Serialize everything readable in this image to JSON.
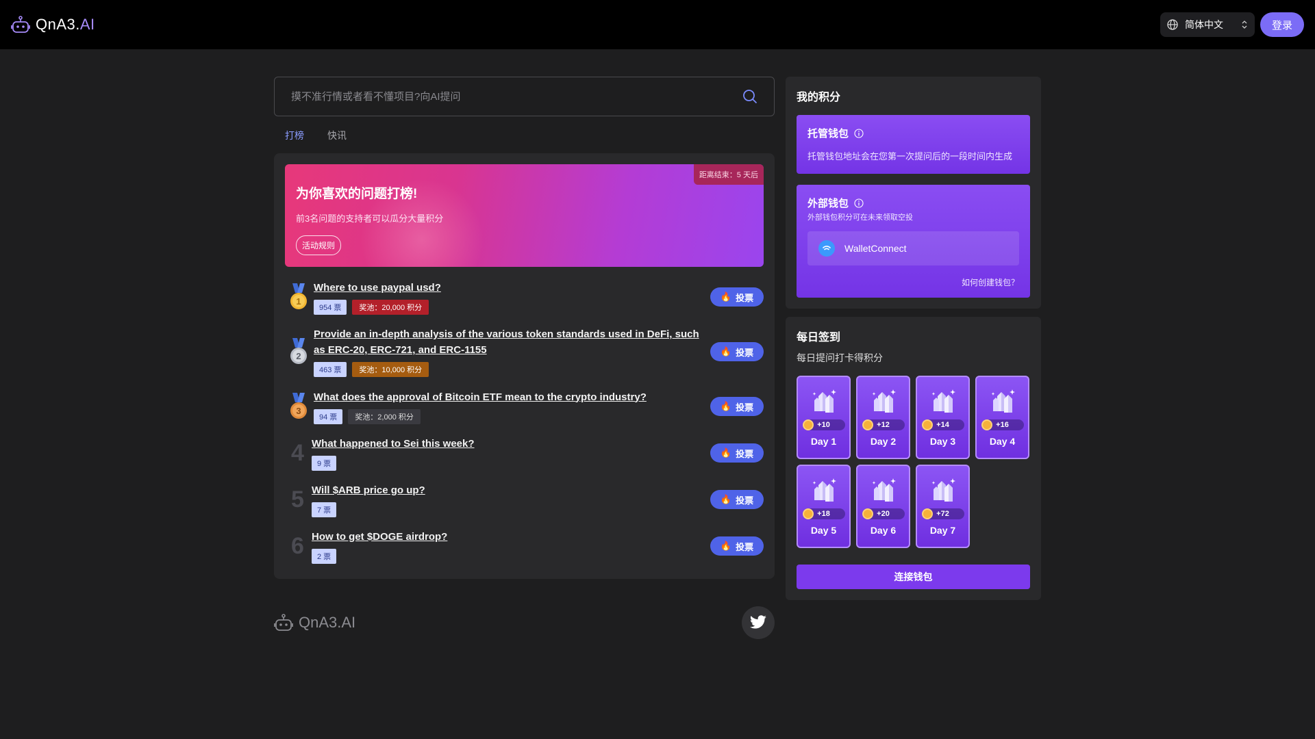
{
  "header": {
    "brand_main": "QnA3.",
    "brand_ai": "AI",
    "language": "简体中文",
    "login": "登录"
  },
  "search": {
    "placeholder": "摸不准行情或者看不懂项目?向AI提问"
  },
  "tabs": [
    {
      "label": "打榜",
      "active": true
    },
    {
      "label": "快讯",
      "active": false
    }
  ],
  "banner": {
    "title": "为你喜欢的问题打榜!",
    "subtitle": "前3名问题的支持者可以瓜分大量积分",
    "rules": "活动规则",
    "countdown": "距离结束：5 天后"
  },
  "questions": [
    {
      "rank": "1",
      "title": "Where to use paypal usd?",
      "votes": "954 票",
      "pool": "奖池：20,000 积分",
      "vote_label": "投票"
    },
    {
      "rank": "2",
      "title": "Provide an in-depth analysis of the various token standards used in DeFi, such as ERC-20, ERC-721, and ERC-1155",
      "votes": "463 票",
      "pool": "奖池：10,000 积分",
      "vote_label": "投票"
    },
    {
      "rank": "3",
      "title": "What does the approval of Bitcoin ETF mean to the crypto industry?",
      "votes": "94 票",
      "pool": "奖池：2,000 积分",
      "vote_label": "投票"
    },
    {
      "rank": "4",
      "title": "What happened to Sei this week?",
      "votes": "9 票",
      "vote_label": "投票"
    },
    {
      "rank": "5",
      "title": "Will $ARB price go up?",
      "votes": "7 票",
      "vote_label": "投票"
    },
    {
      "rank": "6",
      "title": "How to get $DOGE airdrop?",
      "votes": "2 票",
      "vote_label": "投票"
    }
  ],
  "footer": {
    "brand": "QnA3.AI"
  },
  "points": {
    "title": "我的积分",
    "custodial": {
      "title": "托管钱包",
      "desc": "托管钱包地址会在您第一次提问后的一段时间内生成"
    },
    "external": {
      "title": "外部钱包",
      "desc": "外部钱包积分可在未来领取空投",
      "walletconnect": "WalletConnect",
      "how": "如何创建钱包？"
    }
  },
  "checkin": {
    "title": "每日签到",
    "subtitle": "每日提问打卡得积分",
    "days": [
      {
        "label": "Day 1",
        "reward": "+10"
      },
      {
        "label": "Day 2",
        "reward": "+12"
      },
      {
        "label": "Day 3",
        "reward": "+14"
      },
      {
        "label": "Day 4",
        "reward": "+16"
      },
      {
        "label": "Day 5",
        "reward": "+18"
      },
      {
        "label": "Day 6",
        "reward": "+20"
      },
      {
        "label": "Day 7",
        "reward": "+72"
      }
    ],
    "connect": "连接钱包"
  },
  "colors": {
    "accent": "#7c3aed",
    "vote": "#4f63e8",
    "gold": "#f2b632",
    "silver": "#c9ccd3",
    "bronze": "#e08a3a"
  }
}
